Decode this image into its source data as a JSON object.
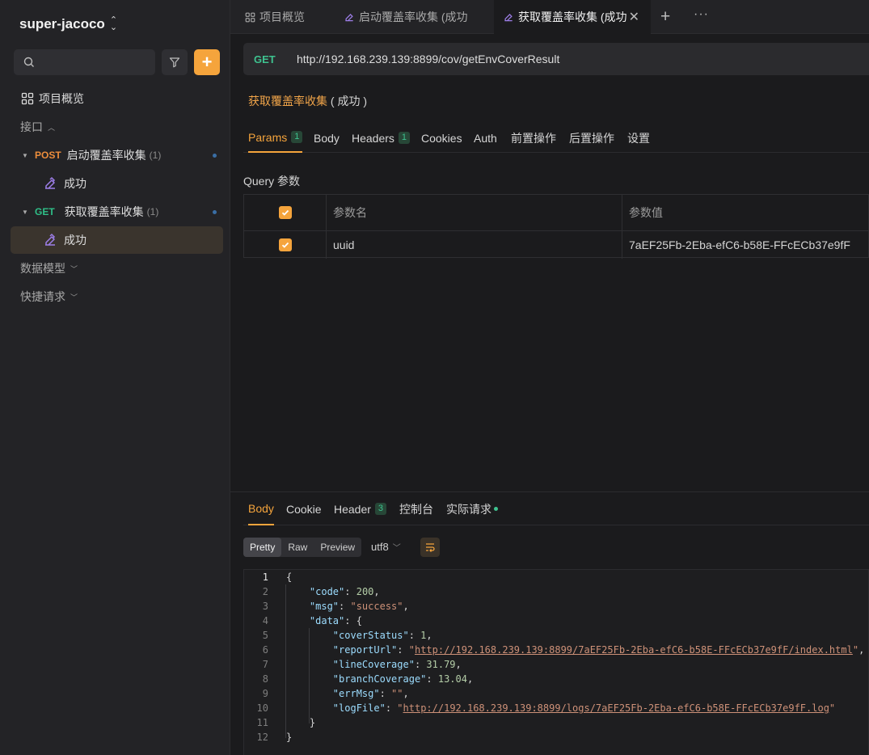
{
  "sidebar": {
    "project_name": "super-jacoco",
    "search_placeholder": "",
    "overview_label": "项目概览",
    "interfaces_label": "接口",
    "data_model_label": "数据模型",
    "quick_request_label": "快捷请求",
    "endpoints": [
      {
        "method": "POST",
        "name": "启动覆盖率收集",
        "count": "(1)",
        "case_label": "成功"
      },
      {
        "method": "GET",
        "name": "获取覆盖率收集",
        "count": "(1)",
        "case_label": "成功"
      }
    ]
  },
  "tabs": [
    {
      "label": "项目概览"
    },
    {
      "label": "启动覆盖率收集 (成功"
    },
    {
      "label": "获取覆盖率收集 (成功"
    }
  ],
  "request": {
    "method": "GET",
    "url": "http://192.168.239.139:8899/cov/getEnvCoverResult",
    "title_name": "获取覆盖率收集",
    "title_status": "( 成功 )",
    "tabs": [
      {
        "label": "Params",
        "badge": "1"
      },
      {
        "label": "Body"
      },
      {
        "label": "Headers",
        "badge": "1"
      },
      {
        "label": "Cookies"
      },
      {
        "label": "Auth"
      },
      {
        "label": "前置操作"
      },
      {
        "label": "后置操作"
      },
      {
        "label": "设置"
      }
    ],
    "query_label": "Query 参数",
    "table": {
      "col_name": "参数名",
      "col_value": "参数值",
      "rows": [
        {
          "name": "uuid",
          "value": "7aEF25Fb-2Eba-efC6-b58E-FFcECb37e9fF"
        }
      ]
    }
  },
  "response": {
    "tabs": [
      {
        "label": "Body"
      },
      {
        "label": "Cookie"
      },
      {
        "label": "Header",
        "badge": "3"
      },
      {
        "label": "控制台"
      },
      {
        "label": "实际请求"
      }
    ],
    "view_modes": [
      "Pretty",
      "Raw",
      "Preview"
    ],
    "encoding": "utf8",
    "json": {
      "code_key": "\"code\"",
      "code_val": "200",
      "msg_key": "\"msg\"",
      "msg_val": "\"success\"",
      "data_key": "\"data\"",
      "coverStatus_key": "\"coverStatus\"",
      "coverStatus_val": "1",
      "reportUrl_key": "\"reportUrl\"",
      "reportUrl_val": "http://192.168.239.139:8899/7aEF25Fb-2Eba-efC6-b58E-FFcECb37e9fF/index.html",
      "lineCoverage_key": "\"lineCoverage\"",
      "lineCoverage_val": "31.79",
      "branchCoverage_key": "\"branchCoverage\"",
      "branchCoverage_val": "13.04",
      "errMsg_key": "\"errMsg\"",
      "errMsg_val": "\"\"",
      "logFile_key": "\"logFile\"",
      "logFile_val": "http://192.168.239.139:8899/logs/7aEF25Fb-2Eba-efC6-b58E-FFcECb37e9fF.log"
    },
    "line_numbers": [
      "1",
      "2",
      "3",
      "4",
      "5",
      "6",
      "7",
      "8",
      "9",
      "10",
      "11",
      "12"
    ]
  },
  "colors": {
    "accent": "#f5a43c",
    "get": "#3ec28f",
    "post": "#ec8d3c"
  }
}
